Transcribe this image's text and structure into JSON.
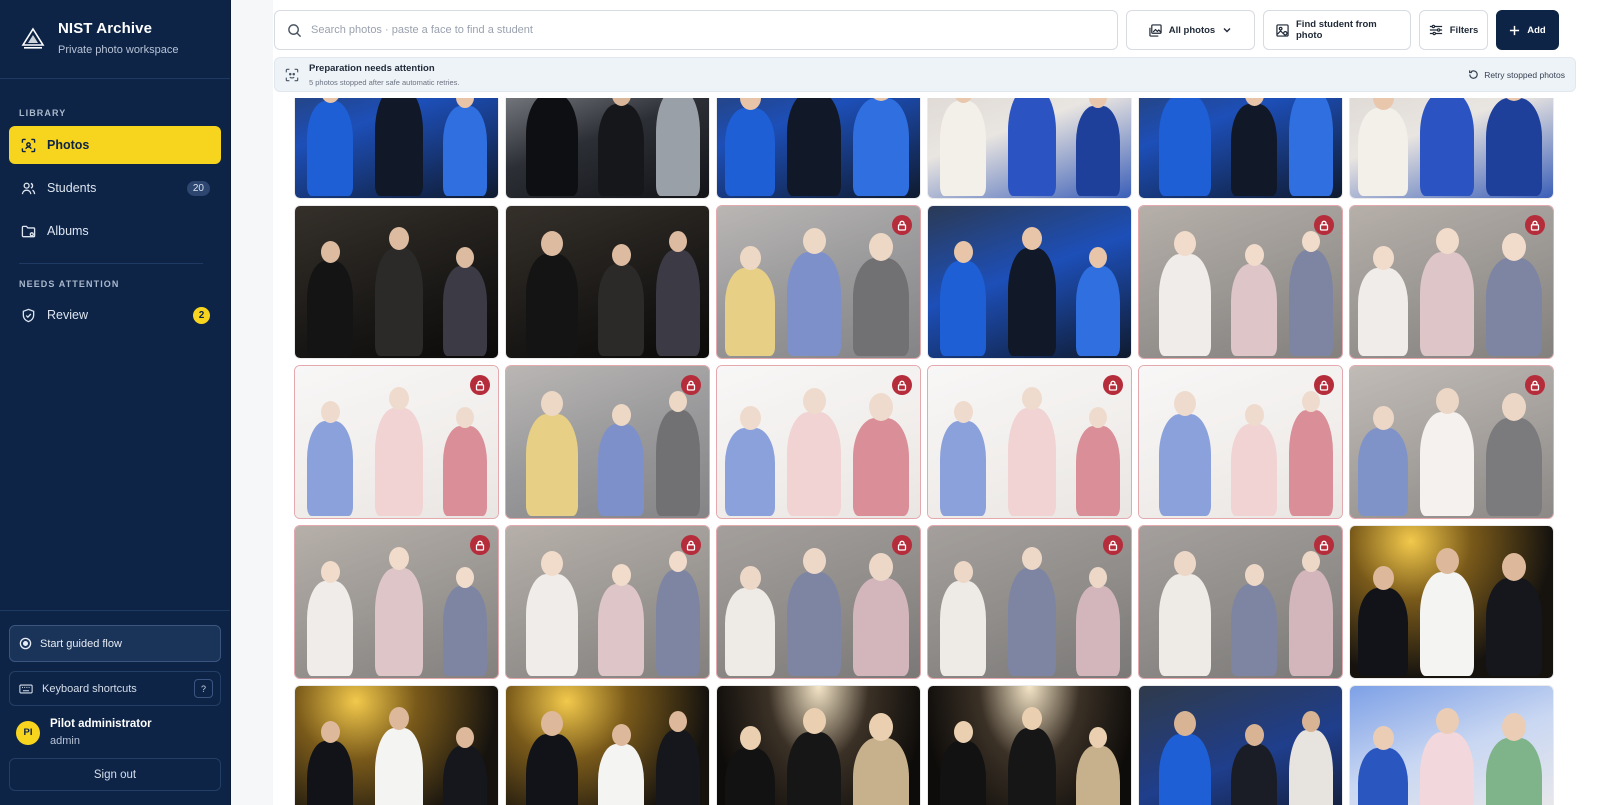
{
  "app": {
    "title": "NIST Archive",
    "subtitle": "Private photo workspace"
  },
  "sidebar": {
    "library_label": "LIBRARY",
    "items": [
      {
        "label": "Photos",
        "icon": "scan-face-icon",
        "active": true
      },
      {
        "label": "Students",
        "icon": "users-icon",
        "count": "20"
      },
      {
        "label": "Albums",
        "icon": "folder-icon"
      }
    ],
    "attention_label": "NEEDS ATTENTION",
    "attention_items": [
      {
        "label": "Review",
        "icon": "shield-check-icon",
        "count": "2"
      }
    ],
    "guided_label": "Start guided flow",
    "shortcuts_label": "Keyboard shortcuts",
    "shortcuts_key": "?",
    "user": {
      "initials": "PI",
      "name": "Pilot administrator",
      "role": "admin"
    },
    "signout_label": "Sign out"
  },
  "toolbar": {
    "search_placeholder": "Search photos · paste a face to find a student",
    "all_photos_label": "All photos",
    "find_student_label": "Find student from photo",
    "filters_label": "Filters",
    "add_label": "Add"
  },
  "attention": {
    "title": "Preparation needs attention",
    "subtitle": "5 photos stopped after safe automatic retries.",
    "retry_label": "Retry stopped photos"
  },
  "colors": {
    "sidebar_bg": "#0d2447",
    "accent_yellow": "#f7d51e",
    "lock_red": "#b52c3a"
  },
  "photos": [
    {
      "locked": false,
      "scene": "blue-gowns"
    },
    {
      "locked": false,
      "scene": "black-dress"
    },
    {
      "locked": false,
      "scene": "blue-gowns"
    },
    {
      "locked": false,
      "scene": "light"
    },
    {
      "locked": false,
      "scene": "blue-gowns"
    },
    {
      "locked": false,
      "scene": "light"
    },
    {
      "locked": false,
      "scene": "dark-party"
    },
    {
      "locked": false,
      "scene": "dark-party"
    },
    {
      "locked": true,
      "scene": "group-light"
    },
    {
      "locked": false,
      "scene": "blue-gowns"
    },
    {
      "locked": true,
      "scene": "crowd"
    },
    {
      "locked": true,
      "scene": "crowd"
    },
    {
      "locked": true,
      "scene": "portrait-bouquet"
    },
    {
      "locked": true,
      "scene": "group-light"
    },
    {
      "locked": true,
      "scene": "portrait-bouquet"
    },
    {
      "locked": true,
      "scene": "portrait-bouquet"
    },
    {
      "locked": true,
      "scene": "portrait-bouquet"
    },
    {
      "locked": true,
      "scene": "hug"
    },
    {
      "locked": true,
      "scene": "crowd"
    },
    {
      "locked": true,
      "scene": "crowd"
    },
    {
      "locked": true,
      "scene": "crowd-dark"
    },
    {
      "locked": true,
      "scene": "crowd-dark"
    },
    {
      "locked": true,
      "scene": "crowd-dark"
    },
    {
      "locked": false,
      "scene": "lights-night"
    },
    {
      "locked": false,
      "scene": "lights-night"
    },
    {
      "locked": false,
      "scene": "lights-night"
    },
    {
      "locked": false,
      "scene": "night-women"
    },
    {
      "locked": false,
      "scene": "night-women"
    },
    {
      "locked": false,
      "scene": "blue-hug"
    },
    {
      "locked": false,
      "scene": "blue-bouquet"
    }
  ]
}
